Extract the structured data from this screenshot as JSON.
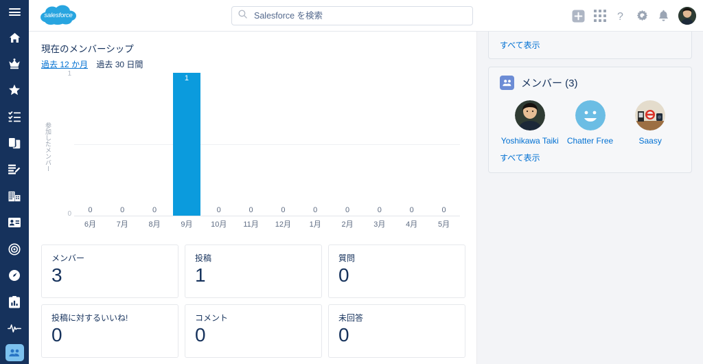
{
  "header": {
    "menu_icon": "hamburger-menu-icon",
    "logo_text": "salesforce",
    "search": {
      "placeholder": "Salesforce を検索",
      "value": "",
      "icon": "search-icon"
    },
    "actions": [
      {
        "name": "add-favorite-icon",
        "label": "+"
      },
      {
        "name": "app-launcher-icon",
        "label": ""
      },
      {
        "name": "help-icon",
        "label": "?"
      },
      {
        "name": "setup-gear-icon",
        "label": ""
      },
      {
        "name": "notifications-bell-icon",
        "label": ""
      },
      {
        "name": "user-avatar",
        "label": ""
      }
    ]
  },
  "sidebar": {
    "items": [
      {
        "name": "sidebar-item-home",
        "icon": "home-icon"
      },
      {
        "name": "sidebar-item-crown",
        "icon": "crown-icon"
      },
      {
        "name": "sidebar-item-star",
        "icon": "star-icon"
      },
      {
        "name": "sidebar-item-tasks",
        "icon": "checklist-icon"
      },
      {
        "name": "sidebar-item-files",
        "icon": "copy-files-icon"
      },
      {
        "name": "sidebar-item-edit-list",
        "icon": "edit-list-icon"
      },
      {
        "name": "sidebar-item-company",
        "icon": "building-icon"
      },
      {
        "name": "sidebar-item-contacts",
        "icon": "id-card-icon"
      },
      {
        "name": "sidebar-item-goals",
        "icon": "target-icon"
      },
      {
        "name": "sidebar-item-performance",
        "icon": "speedometer-icon"
      },
      {
        "name": "sidebar-item-reports",
        "icon": "clipboard-chart-icon"
      },
      {
        "name": "sidebar-item-activity",
        "icon": "pulse-line-icon"
      },
      {
        "name": "sidebar-item-chatter-active",
        "icon": "chatter-group-icon"
      }
    ]
  },
  "chart_data": {
    "type": "bar",
    "title": "現在のメンバーシップ",
    "xlabel": "",
    "ylabel": "参加したメンバー",
    "categories": [
      "6月",
      "7月",
      "8月",
      "9月",
      "10月",
      "11月",
      "12月",
      "1月",
      "2月",
      "3月",
      "4月",
      "5月"
    ],
    "values": [
      0,
      0,
      0,
      1,
      0,
      0,
      0,
      0,
      0,
      0,
      0,
      0
    ],
    "ylim": [
      0,
      1
    ],
    "yticks": [
      "0",
      "1"
    ],
    "grid": true,
    "legend": "none",
    "bar_color": "#0b9bdd",
    "range_links": [
      {
        "label": "過去 12 か月",
        "selected": true
      },
      {
        "label": "過去 30 日間",
        "selected": false
      }
    ]
  },
  "stats": {
    "rows": [
      [
        {
          "label": "メンバー",
          "value": "3"
        },
        {
          "label": "投稿",
          "value": "1"
        },
        {
          "label": "質問",
          "value": "0"
        }
      ],
      [
        {
          "label": "投稿に対するいいね!",
          "value": "0"
        },
        {
          "label": "コメント",
          "value": "0"
        },
        {
          "label": "未回答",
          "value": "0"
        }
      ]
    ]
  },
  "side": {
    "top_card": {
      "view_all": "すべて表示"
    },
    "members_card": {
      "icon": "people-group-icon",
      "title": "メンバー (3)",
      "view_all": "すべて表示",
      "members": [
        {
          "name": "Yoshikawa Taiki",
          "avatar": "photo-person"
        },
        {
          "name": "Chatter Free",
          "avatar": "chatter-smiley"
        },
        {
          "name": "Saasy",
          "avatar": "photo-desk"
        }
      ]
    }
  }
}
